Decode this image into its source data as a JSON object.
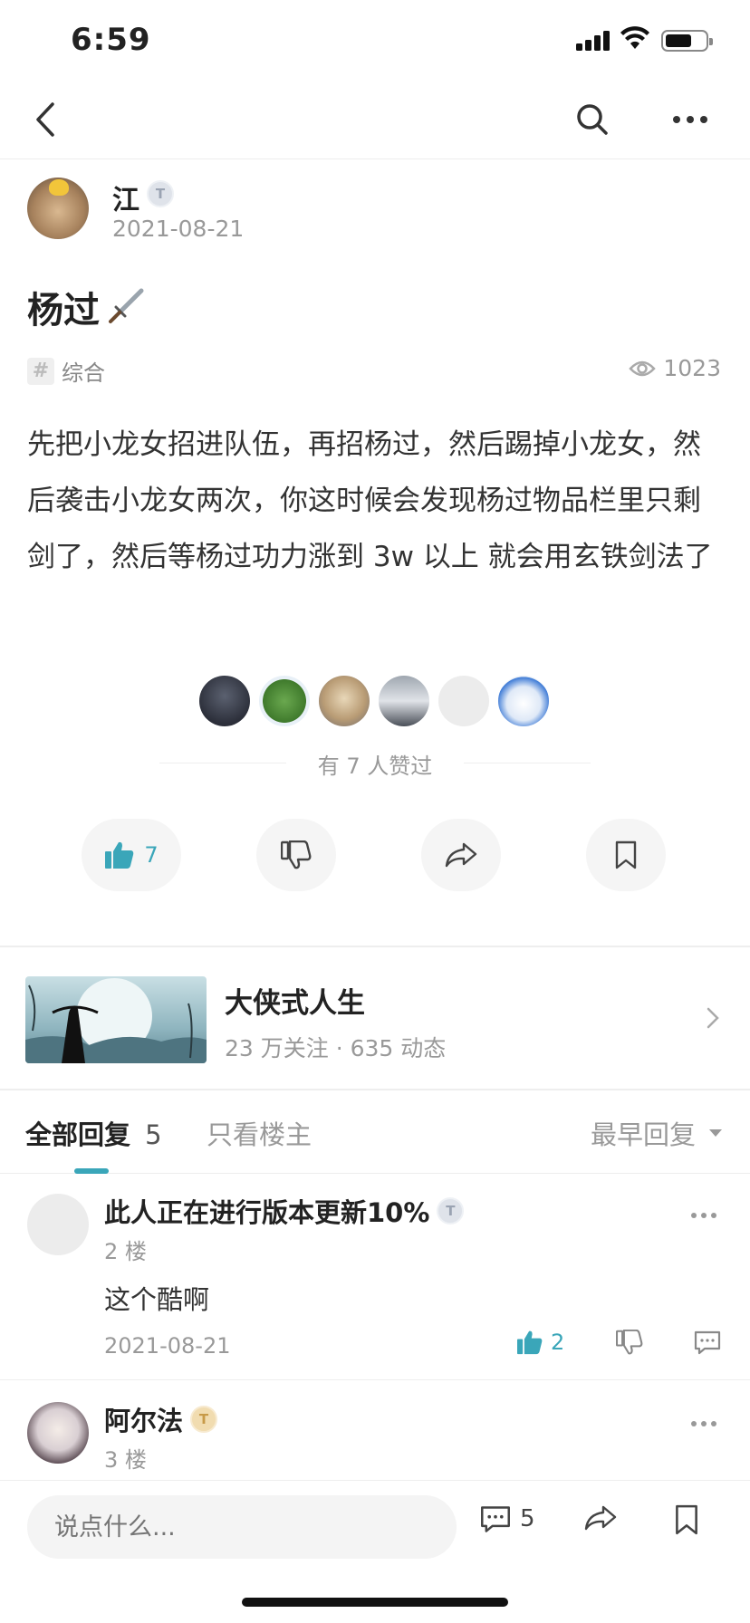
{
  "status_bar": {
    "time": "6:59"
  },
  "post": {
    "author": {
      "name": "江",
      "level": "T3",
      "date": "2021-08-21"
    },
    "title": "杨过",
    "title_icon": "sword-icon",
    "topic": "综合",
    "views": "1023",
    "body": "先把小龙女招进队伍，再招杨过，然后踢掉小龙女，然后袭击小龙女两次，你这时候会发现杨过物品栏里只剩剑了，然后等杨过功力涨到 3w 以上 就会用玄铁剑法了",
    "likes_text": "有 7 人赞过",
    "like_count": "7"
  },
  "game": {
    "name": "大侠式人生",
    "stats": "23 万关注 · 635 动态"
  },
  "tabs": {
    "all_label": "全部回复",
    "all_count": "5",
    "owner_only": "只看楼主",
    "sort": "最早回复"
  },
  "comments": [
    {
      "name": "此人正在进行版本更新10%",
      "level": "T3",
      "floor": "2 楼",
      "text": "这个酷啊",
      "date": "2021-08-21",
      "likes": "2"
    },
    {
      "name": "阿尔法",
      "level": "T4",
      "floor": "3 楼"
    }
  ],
  "bottom_bar": {
    "placeholder": "说点什么...",
    "comment_count": "5"
  },
  "colors": {
    "accent": "#3aa6b9",
    "muted": "#999999"
  }
}
